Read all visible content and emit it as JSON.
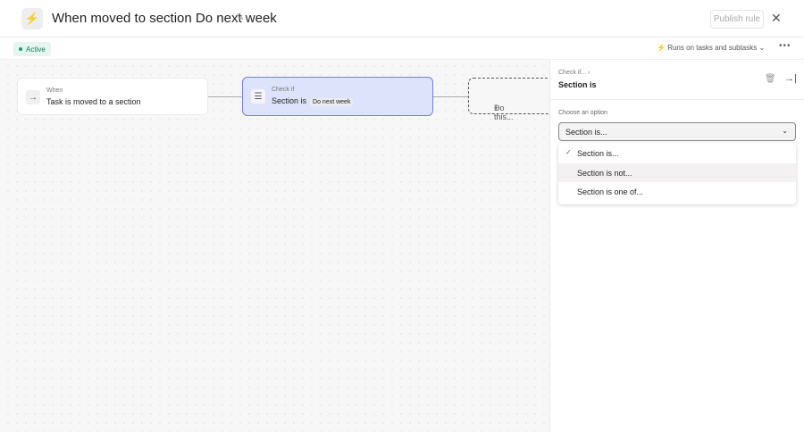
{
  "header": {
    "title": "When moved to section Do next week",
    "publish_label": "Publish rule"
  },
  "subbar": {
    "status": "Active",
    "runs_on": "Runs on tasks and subtasks"
  },
  "canvas": {
    "trigger": {
      "label": "When",
      "value": "Task is moved to a section"
    },
    "condition": {
      "label": "Check if",
      "value": "Section is",
      "chip": "Do next week"
    },
    "action": {
      "label": "Do this..."
    }
  },
  "panel": {
    "breadcrumb": "Check if...",
    "title": "Section is",
    "choose_label": "Choose an option",
    "selected": "Section is...",
    "options": [
      "Section is...",
      "Section is not...",
      "Section is one of..."
    ]
  }
}
